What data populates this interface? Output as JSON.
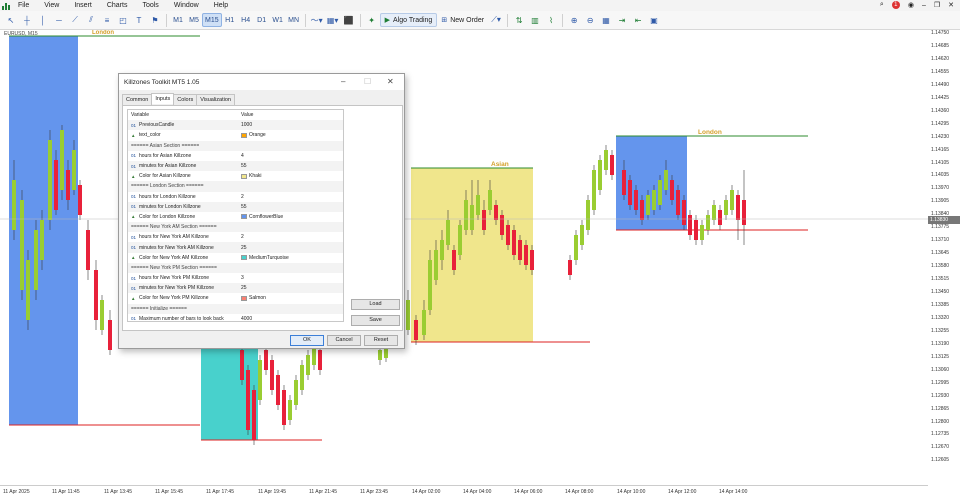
{
  "menu": {
    "items": [
      "File",
      "View",
      "Insert",
      "Charts",
      "Tools",
      "Window",
      "Help"
    ]
  },
  "toolbar": {
    "timeframes": [
      "M1",
      "M5",
      "M15",
      "H1",
      "H4",
      "D1",
      "W1",
      "MN"
    ],
    "active_timeframe": "M15",
    "algo_label": "Algo Trading",
    "new_order_label": "New Order",
    "notification_count": "1"
  },
  "chart": {
    "symbol_label": "EURUSD, M15",
    "price_axis": [
      "1.14750",
      "1.14685",
      "1.14620",
      "1.14555",
      "1.14490",
      "1.14425",
      "1.14360",
      "1.14295",
      "1.14230",
      "1.14165",
      "1.14105",
      "1.14035",
      "1.13970",
      "1.13905",
      "1.13840",
      "1.13775",
      "1.13710",
      "1.13645",
      "1.13580",
      "1.13515",
      "1.13450",
      "1.13385",
      "1.13320",
      "1.13255",
      "1.13190",
      "1.13125",
      "1.13060",
      "1.12995",
      "1.12930",
      "1.12865",
      "1.12800",
      "1.12735",
      "1.12670",
      "1.12605"
    ],
    "current_price": "1.13830",
    "time_axis": [
      "11 Apr 2025",
      "11 Apr 11:45",
      "11 Apr 13:45",
      "11 Apr 15:45",
      "11 Apr 17:45",
      "11 Apr 19:45",
      "11 Apr 21:45",
      "11 Apr 23:45",
      "14 Apr 02:00",
      "14 Apr 04:00",
      "14 Apr 06:00",
      "14 Apr 08:00",
      "14 Apr 10:00",
      "14 Apr 12:00",
      "14 Apr 14:00"
    ],
    "zone_labels": {
      "london_top": "London",
      "asian": "Asian",
      "london_right": "London"
    },
    "colors": {
      "london": "#6495ED",
      "asian": "#F0E68C",
      "ny_am": "#48D1CC",
      "bull": "#9acd32",
      "bear": "#e8213a"
    }
  },
  "dialog": {
    "title": "Killzones Toolkit MT5 1.05",
    "tabs": [
      "Common",
      "Inputs",
      "Colors",
      "Visualization"
    ],
    "active_tab": "Inputs",
    "header": {
      "variable": "Variable",
      "value": "Value"
    },
    "rows": [
      {
        "type": "01",
        "name": "PreviousCandle",
        "value": "1000"
      },
      {
        "type": "color",
        "name": "text_color",
        "value": "Orange",
        "swatch": "#FFA500"
      },
      {
        "type": "sec",
        "name": "====== Asian Section ======",
        "value": ""
      },
      {
        "type": "01",
        "name": "hours for Asian Killzone",
        "value": "4"
      },
      {
        "type": "01",
        "name": "minutes for Asian Killzone",
        "value": "55"
      },
      {
        "type": "color",
        "name": "Color for Asian Killzone",
        "value": "Khaki",
        "swatch": "#F0E68C"
      },
      {
        "type": "sec",
        "name": "====== London Section ======",
        "value": ""
      },
      {
        "type": "01",
        "name": "hours for London Killzone",
        "value": "2"
      },
      {
        "type": "01",
        "name": "minutes for London Killzone",
        "value": "55"
      },
      {
        "type": "color",
        "name": "Color for London Killzone",
        "value": "CornflowerBlue",
        "swatch": "#6495ED"
      },
      {
        "type": "sec",
        "name": "====== New York AM Section ======",
        "value": ""
      },
      {
        "type": "01",
        "name": "hours for New York AM Killzone",
        "value": "2"
      },
      {
        "type": "01",
        "name": "minutes for New York AM Killzone",
        "value": "25"
      },
      {
        "type": "color",
        "name": "Color for New York AM Killzone",
        "value": "MediumTurquoise",
        "swatch": "#48D1CC"
      },
      {
        "type": "sec",
        "name": "====== New York PM Section ======",
        "value": ""
      },
      {
        "type": "01",
        "name": "hours for New York PM Killzone",
        "value": "3"
      },
      {
        "type": "01",
        "name": "minutes for New York PM Killzone",
        "value": "25"
      },
      {
        "type": "color",
        "name": "Color for New York PM Killzone",
        "value": "Salmon",
        "swatch": "#FA8072"
      },
      {
        "type": "sec",
        "name": "====== Initialize ======",
        "value": ""
      },
      {
        "type": "01",
        "name": "Maximum number of bars to look back",
        "value": "4000"
      }
    ],
    "load_label": "Load",
    "save_label": "Save",
    "ok_label": "OK",
    "cancel_label": "Cancel",
    "reset_label": "Reset"
  }
}
